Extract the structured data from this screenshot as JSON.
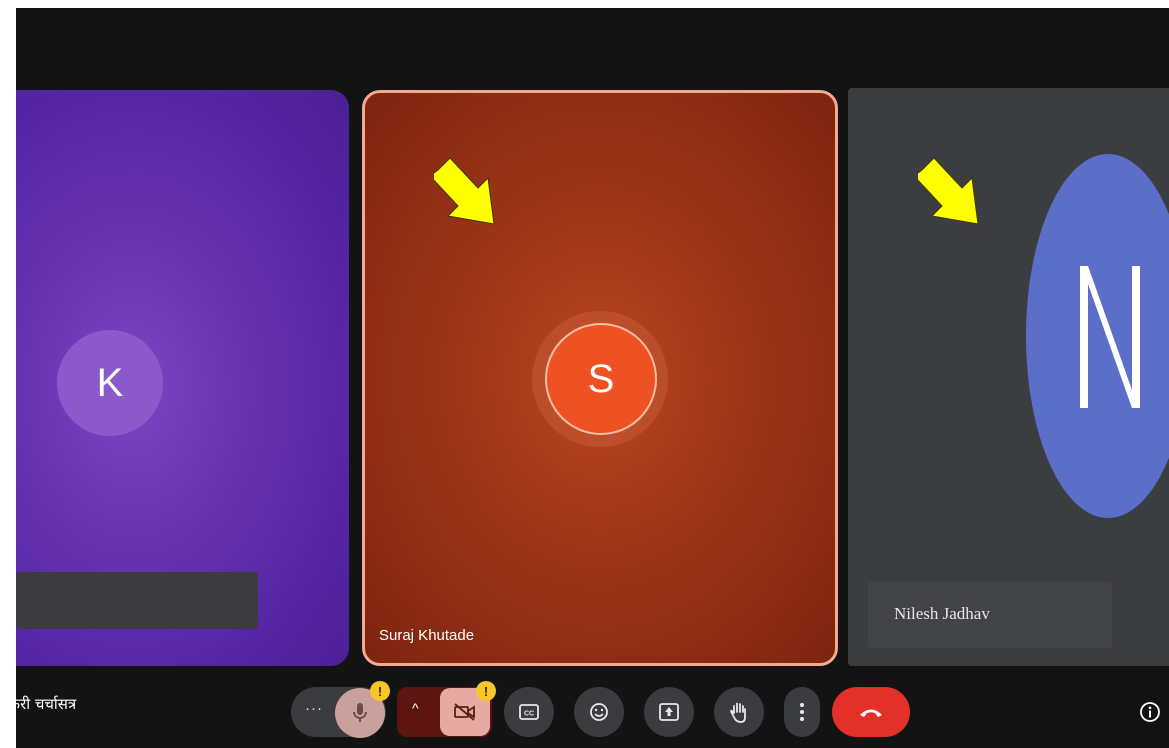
{
  "participants": [
    {
      "initial": "K",
      "name": ""
    },
    {
      "initial": "S",
      "name": "Suraj Khutade"
    },
    {
      "initial": "N",
      "name": "Nilesh Jadhav"
    }
  ],
  "meeting": {
    "title": "तकरी चर्चासत्र"
  },
  "toolbar": {
    "more_label": "···",
    "mic_badge": "!",
    "cam_badge": "!",
    "chevron": "^"
  },
  "icons": {
    "mic": "mic-icon",
    "camera_off": "camera-off-icon",
    "captions": "captions-icon",
    "emoji": "emoji-icon",
    "present": "present-screen-icon",
    "hand": "raise-hand-icon",
    "more": "more-vert-icon",
    "end_call": "end-call-icon",
    "info": "info-icon",
    "arrows": "yellow-arrow-icon"
  },
  "colors": {
    "tile_k": "#6532b0",
    "tile_s": "#a5381a",
    "tile_n": "#3c3d40",
    "avatar_s": "#ee5122",
    "avatar_n": "#5c6fc8",
    "end_call": "#e3312a",
    "arrow": "#ffff00"
  }
}
